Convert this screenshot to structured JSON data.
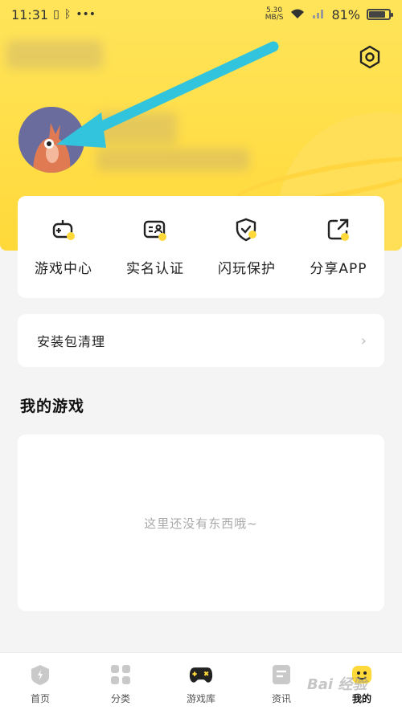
{
  "status_bar": {
    "time": "11:31",
    "net_speed_value": "5.30",
    "net_speed_unit": "MB/S",
    "battery": "81%"
  },
  "quick_actions": [
    {
      "label": "游戏中心",
      "icon": "gamepad-plus-icon"
    },
    {
      "label": "实名认证",
      "icon": "id-card-icon"
    },
    {
      "label": "闪玩保护",
      "icon": "shield-check-icon"
    },
    {
      "label": "分享APP",
      "icon": "share-icon"
    }
  ],
  "clean_item": {
    "label": "安装包清理"
  },
  "my_games": {
    "title": "我的游戏",
    "empty_text": "这里还没有东西哦~"
  },
  "tabbar": {
    "tabs": [
      {
        "label": "首页",
        "icon": "home-icon",
        "active": false
      },
      {
        "label": "分类",
        "icon": "category-icon",
        "active": false
      },
      {
        "label": "游戏库",
        "icon": "game-library-icon",
        "active": false
      },
      {
        "label": "资讯",
        "icon": "news-icon",
        "active": false
      },
      {
        "label": "我的",
        "icon": "profile-icon",
        "active": true
      }
    ]
  },
  "watermark": "Bai 经验",
  "colors": {
    "brand_yellow": "#ffd93a",
    "accent_cyan": "#33c4dd"
  }
}
